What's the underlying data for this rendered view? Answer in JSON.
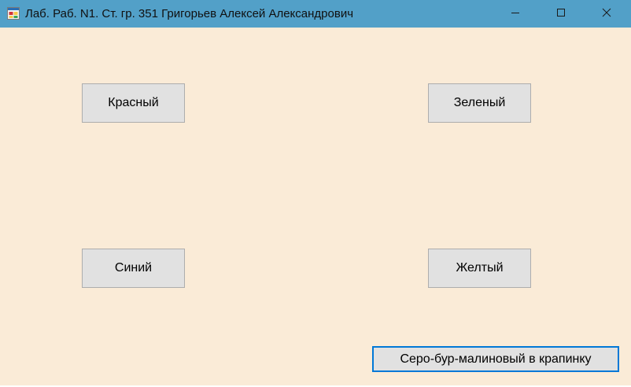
{
  "window": {
    "title": "Лаб. Раб. N1. Ст. гр. 351 Григорьев Алексей Александрович",
    "icon": "app-form-icon",
    "controls": {
      "minimize_icon": "minimize-icon",
      "maximize_icon": "maximize-icon",
      "close_icon": "close-icon"
    }
  },
  "buttons": {
    "red": "Красный",
    "green": "Зеленый",
    "blue": "Синий",
    "yellow": "Желтый",
    "mix": "Серо-бур-малиновый в крапинку"
  },
  "colors": {
    "titlebar": "#52a0c8",
    "client_background": "#faebd7",
    "button_face": "#e1e1e1",
    "focus_border": "#0078d7"
  }
}
